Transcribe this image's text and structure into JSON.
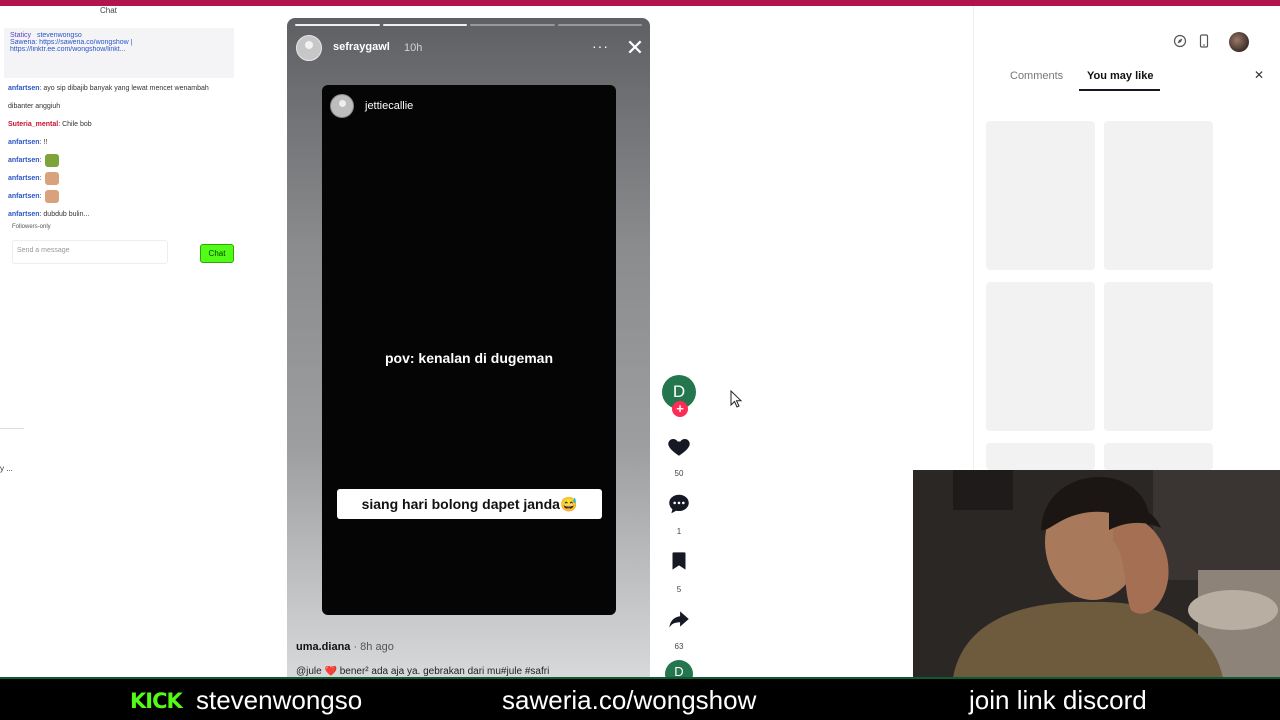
{
  "chat": {
    "title": "Chat",
    "pinned": {
      "user": "Staticy",
      "mention": "stevenwongso",
      "line1": "Saweria: https://saweria.co/wongshow |",
      "line2": "https://linktr.ee.com/wongshow/linkt..."
    },
    "messages": [
      {
        "user": "anfartsen",
        "text": "ayo sip dibajib banyak yang lewat mencet wenambah",
        "red": false
      },
      {
        "user": "",
        "text": "dibanter anggiuh",
        "red": false
      },
      {
        "user": "Suteria_mental",
        "text": "Chile bob",
        "red": true
      },
      {
        "user": "anfartsen",
        "text": "!!",
        "red": false
      },
      {
        "user": "anfartsen",
        "text": "",
        "red": false,
        "emote": "green"
      },
      {
        "user": "anfartsen",
        "text": "",
        "red": false,
        "emote": "face"
      },
      {
        "user": "anfartsen",
        "text": "",
        "red": false,
        "emote": "face"
      },
      {
        "user": "anfartsen",
        "text": "dubdub bulin...",
        "red": false
      }
    ],
    "follow_notice": "Followers-only",
    "input_placeholder": "Send a message",
    "send_label": "Chat",
    "side_fragment": "y ..."
  },
  "story": {
    "username": "sefraygawl",
    "time": "10h",
    "more": "···",
    "close": "✕",
    "progress": [
      true,
      true,
      false,
      false
    ],
    "video": {
      "username": "jettiecallie",
      "overlay_text": "pov: kenalan di dugeman",
      "caption": "siang hari bolong dapet janda😅"
    },
    "author": "uma.diana",
    "author_ago": " · 8h ago",
    "description": "@jule ❤️ bener² ada aja ya. gebrakan dari mu#jule #safri"
  },
  "rail": {
    "avatar_letter": "D",
    "likes": "50",
    "comments": "1",
    "saves": "5",
    "shares": "63",
    "next_letter": "D"
  },
  "right_panel": {
    "tabs": [
      "Comments",
      "You may like"
    ],
    "active_tab": "You may like",
    "close": "✕"
  },
  "bottom_bar": {
    "logo": "KICK",
    "channel": "stevenwongso",
    "saweria": "saweria.co/wongshow",
    "discord": "join link discord"
  },
  "colors": {
    "accent_kick": "#53fc18",
    "stripe": "#b0154f",
    "follow_badge": "#fe2c55",
    "rail_avatar": "#23764d"
  }
}
